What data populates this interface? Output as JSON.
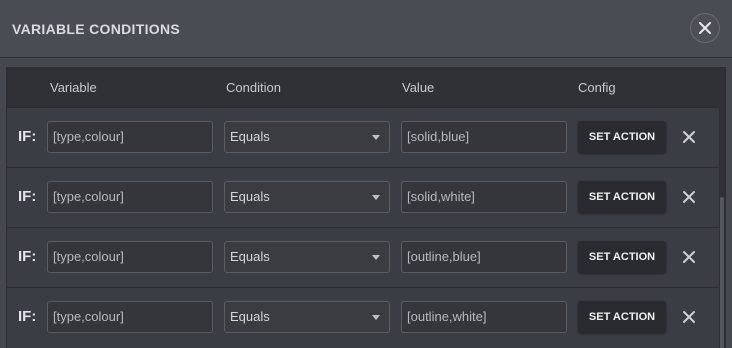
{
  "dialog": {
    "title": "VARIABLE CONDITIONS",
    "close_icon": "close-icon"
  },
  "columns": {
    "variable": "Variable",
    "condition": "Condition",
    "value": "Value",
    "config": "Config"
  },
  "rows": [
    {
      "if_label": "IF:",
      "variable": "[type,colour]",
      "condition": "Equals",
      "value": "[solid,blue]",
      "action": "SET ACTION"
    },
    {
      "if_label": "IF:",
      "variable": "[type,colour]",
      "condition": "Equals",
      "value": "[solid,white]",
      "action": "SET ACTION"
    },
    {
      "if_label": "IF:",
      "variable": "[type,colour]",
      "condition": "Equals",
      "value": "[outline,blue]",
      "action": "SET ACTION"
    },
    {
      "if_label": "IF:",
      "variable": "[type,colour]",
      "condition": "Equals",
      "value": "[outline,white]",
      "action": "SET ACTION"
    }
  ],
  "colors": {
    "background": "#464850",
    "panel": "#3b3d44",
    "button": "#2a2b30"
  }
}
